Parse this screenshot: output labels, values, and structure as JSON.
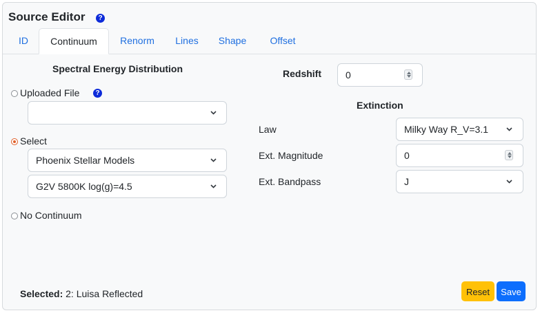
{
  "header": {
    "title": "Source Editor",
    "help_icon": "question-circle-icon"
  },
  "tabs": [
    {
      "label": "ID",
      "active": false
    },
    {
      "label": "Continuum",
      "active": true
    },
    {
      "label": "Renorm",
      "active": false
    },
    {
      "label": "Lines",
      "active": false
    },
    {
      "label": "Shape",
      "active": false
    },
    {
      "label": "Offset",
      "active": false
    }
  ],
  "sed": {
    "heading": "Spectral Energy Distribution",
    "options": {
      "uploaded": {
        "label": "Uploaded File",
        "checked": false,
        "file_value": ""
      },
      "select": {
        "label": "Select",
        "checked": true,
        "model_value": "Phoenix Stellar Models",
        "spectrum_value": "G2V 5800K log(g)=4.5"
      },
      "none": {
        "label": "No Continuum",
        "checked": false
      }
    }
  },
  "redshift": {
    "label": "Redshift",
    "value": "0"
  },
  "extinction": {
    "heading": "Extinction",
    "law": {
      "label": "Law",
      "value": "Milky Way R_V=3.1"
    },
    "magnitude": {
      "label": "Ext. Magnitude",
      "value": "0"
    },
    "bandpass": {
      "label": "Ext. Bandpass",
      "value": "J"
    }
  },
  "footer": {
    "selected_label": "Selected:",
    "selected_value": "2: Luisa Reflected",
    "reset_label": "Reset",
    "save_label": "Save"
  },
  "colors": {
    "accent": "#0d6efd",
    "reset": "#ffc107",
    "radio_checked": "#e0602a",
    "tab_link": "#1f6fe0"
  }
}
